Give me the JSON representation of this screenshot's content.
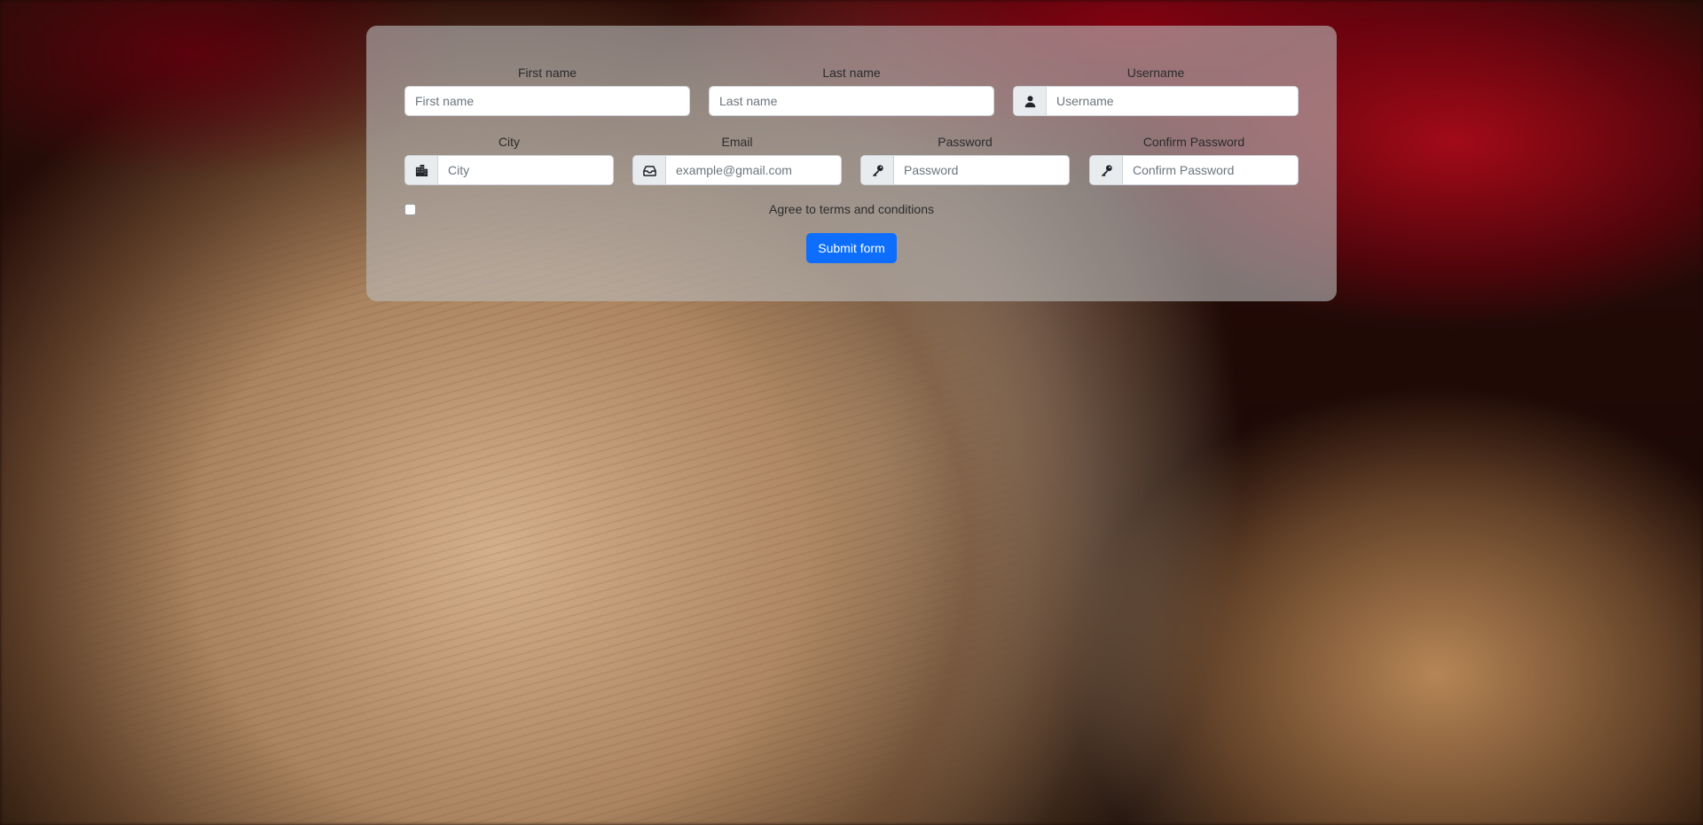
{
  "form": {
    "first_name": {
      "label": "First name",
      "placeholder": "First name",
      "value": ""
    },
    "last_name": {
      "label": "Last name",
      "placeholder": "Last name",
      "value": ""
    },
    "username": {
      "label": "Username",
      "placeholder": "Username",
      "value": "",
      "icon": "user-icon"
    },
    "city": {
      "label": "City",
      "placeholder": "City",
      "value": "",
      "icon": "city-icon"
    },
    "email": {
      "label": "Email",
      "placeholder": "example@gmail.com",
      "value": "",
      "icon": "inbox-icon"
    },
    "password": {
      "label": "Password",
      "placeholder": "Password",
      "value": "",
      "icon": "key-icon"
    },
    "confirm_password": {
      "label": "Confirm Password",
      "placeholder": "Confirm Password",
      "value": "",
      "icon": "key-icon"
    },
    "terms": {
      "label": "Agree to terms and conditions",
      "checked": false
    },
    "submit_label": "Submit form"
  },
  "colors": {
    "primary": "#0d6efd",
    "card_background": "rgba(185,185,185,0.62)",
    "addon_background": "#e9ecef"
  }
}
